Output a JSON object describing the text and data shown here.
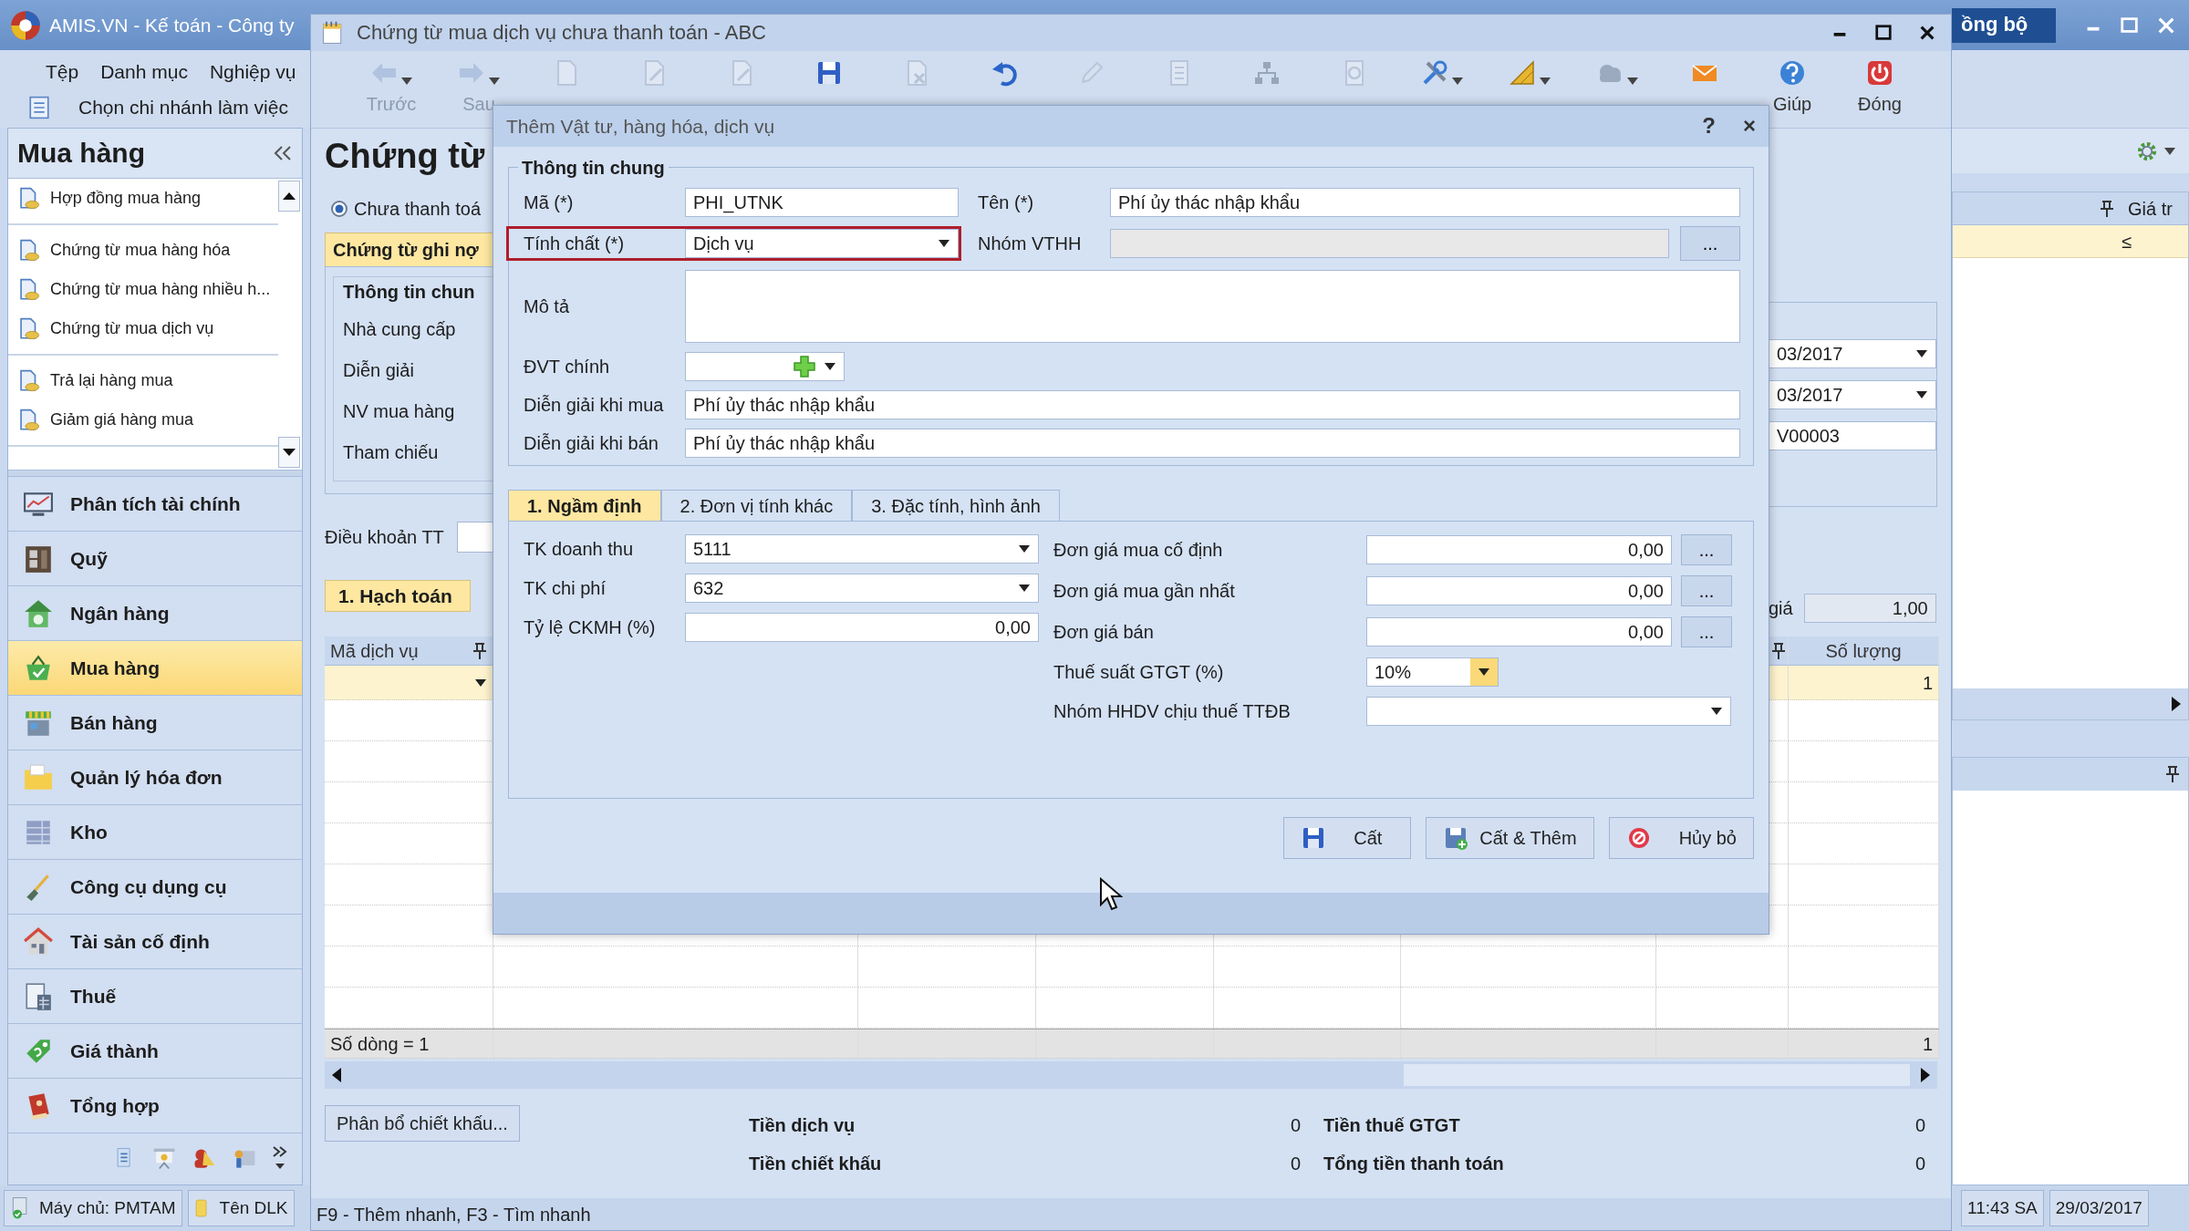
{
  "main_window": {
    "title": "AMIS.VN - Kế toán - Công ty",
    "sync_button": "ồng bộ",
    "menu": [
      "Tệp",
      "Danh mục",
      "Nghiệp vụ"
    ],
    "branch_menu": "Chọn chi nhánh làm việc",
    "sidebar": {
      "title": "Mua hàng",
      "item_groups": [
        [
          "Hợp đồng mua hàng"
        ],
        [
          "Chứng từ mua hàng hóa",
          "Chứng từ mua hàng nhiều h...",
          "Chứng từ mua dịch vụ"
        ],
        [
          "Trả lại hàng mua",
          "Giảm giá hàng mua"
        ]
      ],
      "modules": [
        {
          "label": "Phân tích tài chính",
          "selected": false
        },
        {
          "label": "Quỹ",
          "selected": false
        },
        {
          "label": "Ngân hàng",
          "selected": false
        },
        {
          "label": "Mua hàng",
          "selected": true
        },
        {
          "label": "Bán hàng",
          "selected": false
        },
        {
          "label": "Quản lý hóa đơn",
          "selected": false
        },
        {
          "label": "Kho",
          "selected": false
        },
        {
          "label": "Công cụ dụng cụ",
          "selected": false
        },
        {
          "label": "Tài sản cố định",
          "selected": false
        },
        {
          "label": "Thuế",
          "selected": false
        },
        {
          "label": "Giá thành",
          "selected": false
        },
        {
          "label": "Tổng hợp",
          "selected": false
        }
      ]
    },
    "status": [
      "Máy chủ: PMTAM",
      "Tên DLK"
    ],
    "time": "11:43 SA",
    "date": "29/03/2017",
    "right_grid": {
      "column": "Giá tr",
      "cell": "≤"
    }
  },
  "document_window": {
    "title": "Chứng từ mua dịch vụ chưa thanh toán - ABC",
    "toolbar": [
      {
        "label": "Trước",
        "disabled": true,
        "caret": true
      },
      {
        "label": "Sau",
        "disabled": true,
        "caret": true
      },
      {
        "disabled": true,
        "caret": false
      },
      {
        "disabled": true,
        "caret": false
      },
      {
        "disabled": true,
        "caret": false
      },
      {
        "disabled": false,
        "caret": false
      },
      {
        "disabled": true,
        "caret": false
      },
      {
        "disabled": false,
        "caret": false
      },
      {
        "disabled": true,
        "caret": false
      },
      {
        "disabled": true,
        "caret": false
      },
      {
        "disabled": true,
        "caret": false
      },
      {
        "disabled": true,
        "caret": false
      },
      {
        "disabled": false,
        "caret": true
      },
      {
        "disabled": false,
        "caret": true
      },
      {
        "disabled": true,
        "caret": true
      },
      {
        "disabled": false,
        "caret": false
      },
      {
        "label": "Giúp",
        "disabled": false,
        "caret": false
      },
      {
        "label": "Đóng",
        "disabled": false,
        "caret": false
      }
    ],
    "heading": "Chứng từ",
    "payment_option": {
      "label": "Chưa thanh toá",
      "selected": true
    },
    "voucher_tab": "Chứng từ ghi nợ",
    "info_group": {
      "title": "Thông tin chun",
      "labels": [
        "Nhà cung cấp",
        "Diễn giải",
        "NV mua hàng",
        "Tham chiếu"
      ]
    },
    "right_fields": [
      {
        "value": "03/2017",
        "kind": "date"
      },
      {
        "value": "03/2017",
        "kind": "date"
      },
      {
        "value": "V00003",
        "kind": "text"
      }
    ],
    "payment_terms_label": "Điều khoản TT",
    "rate": {
      "label": "giá",
      "value": "1,00"
    },
    "detail_tab": "1. Hạch toán",
    "grid": {
      "columns": [
        "Mã dịch vụ",
        "Số lượng"
      ],
      "first_row_quantity": "1",
      "footer": "Số dòng = 1",
      "footer_total": "1"
    },
    "allocate_button": "Phân bổ chiết khấu...",
    "totals": [
      {
        "label": "Tiền dịch vụ",
        "value": "0",
        "label_2": "Tiền thuế GTGT",
        "value_2": "0"
      },
      {
        "label": "Tiền chiết khấu",
        "value": "0",
        "label_2": "Tổng tiền thanh toán",
        "value_2": "0"
      }
    ],
    "hint": "F9 - Thêm nhanh, F3 - Tìm nhanh"
  },
  "dialog": {
    "title": "Thêm Vật tư, hàng hóa, dịch vụ",
    "help": "?",
    "close": "×",
    "group_title": "Thông tin chung",
    "rows": [
      [
        {
          "label": "Mã (*)",
          "value": "PHI_UTNK",
          "kind": "text",
          "highlighted": false
        },
        {
          "label": "Tên (*)",
          "value": "Phí ủy thác nhập khẩu",
          "kind": "text",
          "highlighted": false
        }
      ],
      [
        {
          "label": "Tính chất (*)",
          "value": "Dịch vụ",
          "kind": "combo",
          "highlighted": true
        },
        {
          "label": "Nhóm VTHH",
          "kind": "browse",
          "button": "...",
          "highlighted": false
        }
      ],
      [
        {
          "label": "Mô tả",
          "kind": "textarea",
          "highlighted": false
        }
      ],
      [
        {
          "label": "ĐVT chính",
          "kind": "unit",
          "highlighted": false
        }
      ],
      [
        {
          "label": "Diễn giải khi mua",
          "value": "Phí ủy thác nhập khẩu",
          "kind": "text",
          "highlighted": false
        }
      ],
      [
        {
          "label": "Diễn giải khi bán",
          "value": "Phí ủy thác nhập khẩu",
          "kind": "text",
          "highlighted": false
        }
      ]
    ],
    "tabs": [
      {
        "label": "1. Ngầm định",
        "selected": true
      },
      {
        "label": "2. Đơn vị tính khác",
        "selected": false
      },
      {
        "label": "3. Đặc tính, hình ảnh",
        "selected": false
      }
    ],
    "left_fields": [
      {
        "label": "TK doanh thu",
        "value": "5111",
        "kind": "combo"
      },
      {
        "label": "TK chi phí",
        "value": "632",
        "kind": "combo"
      },
      {
        "label": "Tỷ lệ CKMH (%)",
        "value": "0,00",
        "kind": "number"
      }
    ],
    "right_fields": [
      {
        "label": "Đơn giá mua cố định",
        "value": "0,00",
        "kind": "price",
        "button": "..."
      },
      {
        "label": "Đơn giá mua gần nhất",
        "value": "0,00",
        "kind": "price",
        "button": "..."
      },
      {
        "label": "Đơn giá bán",
        "value": "0,00",
        "kind": "price",
        "button": "..."
      },
      {
        "label": "Thuế suất GTGT (%)",
        "value": "10%",
        "kind": "rate"
      },
      {
        "label": "Nhóm HHDV chịu thuế TTĐB",
        "kind": "combo"
      }
    ],
    "buttons": [
      {
        "label": "Cất"
      },
      {
        "label": "Cất & Thêm"
      },
      {
        "label": "Hủy bỏ"
      }
    ]
  }
}
